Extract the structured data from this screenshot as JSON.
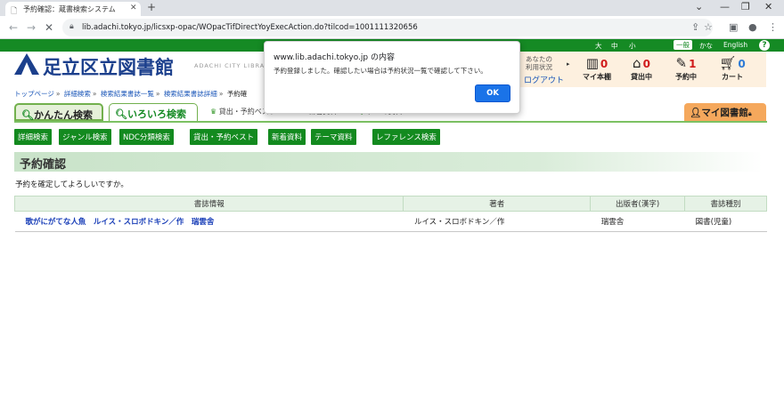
{
  "browser": {
    "tab_title": "予約確認：蔵書検索システム",
    "tab_icon": "document-icon",
    "new_tab": "+",
    "url": "lib.adachi.tokyo.jp/licsxp-opac/WOpacTifDirectYoyExecAction.do?tilcod=1001111320656"
  },
  "top_links": {
    "large": "大",
    "medium": "中",
    "small": "小",
    "general": "一般",
    "kana": "かな",
    "english": "English",
    "help": "?"
  },
  "site": {
    "name": "足立区立図書館",
    "name_en": "ADACHI CITY LIBRA"
  },
  "status": {
    "your_usage": "あなたの\n利用状況",
    "logout": "ログアウト",
    "items": [
      {
        "label": "マイ本棚",
        "count": "0",
        "icon": "bookshelf-icon"
      },
      {
        "label": "貸出中",
        "count": "0",
        "icon": "house-icon"
      },
      {
        "label": "予約中",
        "count": "1",
        "icon": "reserve-icon"
      },
      {
        "label": "カート",
        "count": "0",
        "icon": "cart-icon"
      }
    ]
  },
  "breadcrumb": [
    "トップページ",
    "詳細検索",
    "検索結果書誌一覧",
    "検索結果書誌詳細",
    "予約確"
  ],
  "tabs": {
    "easy": "かんたん検索",
    "various": "いろいろ検索",
    "best": "貸出・予約ベスト",
    "new": "新着資料",
    "theme": "テーマ資料",
    "mylib": "マイ図書館"
  },
  "buttons": [
    "詳細検索",
    "ジャンル検索",
    "NDC分類検索",
    "貸出・予約ベスト",
    "新着資料",
    "テーマ資料",
    "レファレンス検索"
  ],
  "section_title": "予約確認",
  "confirm_text": "予約を確定してよろしいですか。",
  "table": {
    "headers": [
      "書誌情報",
      "著者",
      "出版者(漢字)",
      "書誌種別"
    ],
    "rows": [
      {
        "title": "歌がにがてな人魚　ルイス・スロボドキン／作　瑞雲舎",
        "author": "ルイス・スロボドキン／作",
        "publisher": "瑞雲舎",
        "type": "図書(児童)"
      }
    ]
  },
  "dialog": {
    "origin": "www.lib.adachi.tokyo.jp の内容",
    "message": "予約登録しました。確認したい場合は予約状況一覧で確認して下さい。",
    "ok": "OK"
  },
  "colors": {
    "brand_green": "#158a24",
    "brand_blue": "#1b3f8c",
    "link_blue": "#1a56b8",
    "count_red": "#d01b1b"
  }
}
